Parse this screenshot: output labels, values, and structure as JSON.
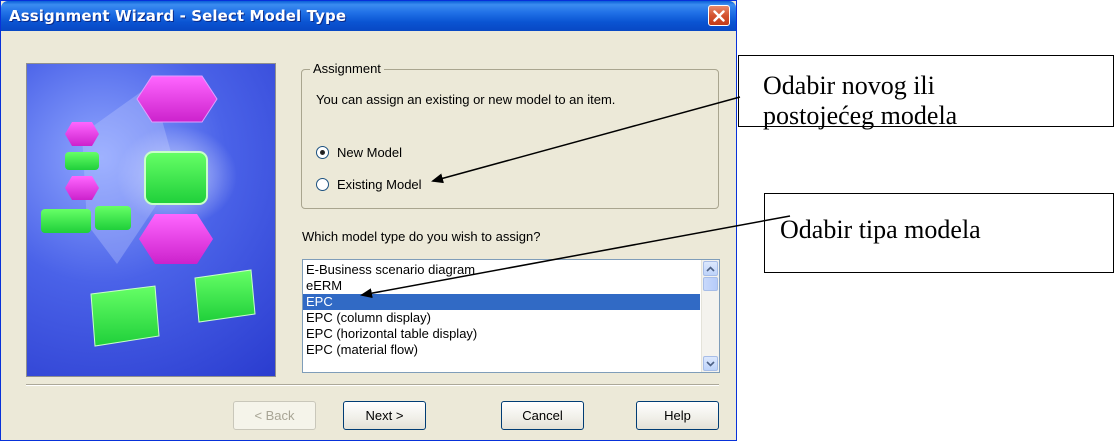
{
  "window": {
    "title": "Assignment Wizard - Select Model Type",
    "close_icon": "close-icon"
  },
  "assignment_group": {
    "legend": "Assignment",
    "description": "You can assign an existing or new model to an item.",
    "options": [
      {
        "label": "New Model",
        "checked": true
      },
      {
        "label": "Existing Model",
        "checked": false
      }
    ]
  },
  "model_type": {
    "question": "Which model type do you wish to assign?",
    "items": [
      {
        "label": "E-Business scenario diagram",
        "selected": false
      },
      {
        "label": "eERM",
        "selected": false
      },
      {
        "label": "EPC",
        "selected": true
      },
      {
        "label": "EPC (column display)",
        "selected": false
      },
      {
        "label": "EPC (horizontal table display)",
        "selected": false
      },
      {
        "label": "EPC (material flow)",
        "selected": false
      }
    ]
  },
  "buttons": {
    "back": "< Back",
    "next": "Next >",
    "cancel": "Cancel",
    "help": "Help"
  },
  "callouts": {
    "first_line1": "Odabir novog ili",
    "first_line2": "postojećeg modela",
    "second": "Odabir tipa modela"
  },
  "colors": {
    "title_bar": "#0a54d2",
    "selection": "#316ac5",
    "close_button": "#d4532f"
  }
}
